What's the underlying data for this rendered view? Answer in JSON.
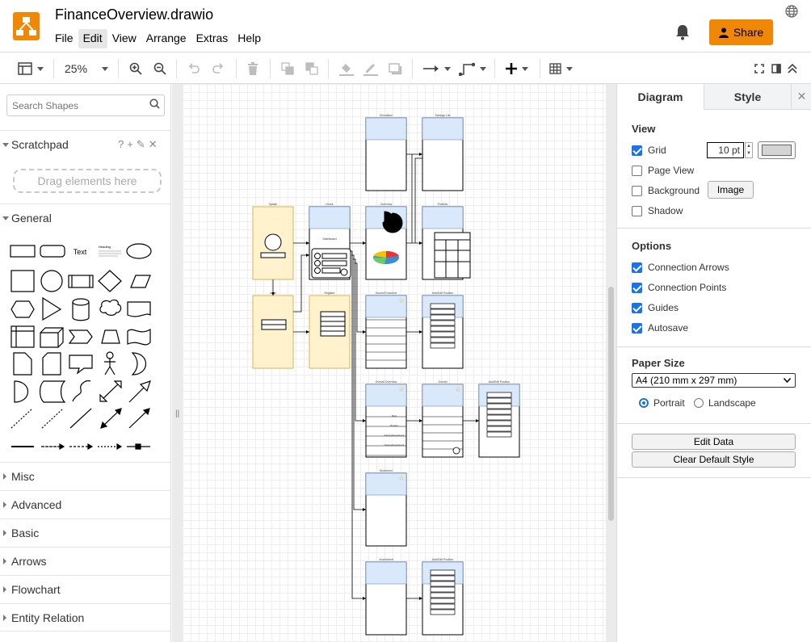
{
  "app": {
    "title": "FinanceOverview.drawio",
    "menu": [
      "File",
      "Edit",
      "View",
      "Arrange",
      "Extras",
      "Help"
    ],
    "share_label": "Share"
  },
  "toolbar": {
    "zoom": "25%"
  },
  "sidebar": {
    "search_placeholder": "Search Shapes",
    "scratchpad_label": "Scratchpad",
    "scratchpad_drop": "Drag elements here",
    "general_label": "General",
    "shape_text_label": "Text",
    "shape_heading_label": "Heading",
    "sections": [
      "Misc",
      "Advanced",
      "Basic",
      "Arrows",
      "Flowchart",
      "Entity Relation"
    ]
  },
  "diagram": {
    "screens": [
      {
        "id": "s1",
        "label": "Simulation"
      },
      {
        "id": "s2",
        "label": "Savings List"
      },
      {
        "id": "s3",
        "label": "Splash"
      },
      {
        "id": "s4",
        "label": "Home"
      },
      {
        "id": "s5",
        "label": "Overview"
      },
      {
        "id": "s6",
        "label": "Portfolio"
      },
      {
        "id": "s7",
        "label": "Login"
      },
      {
        "id": "s8",
        "label": "Register"
      },
      {
        "id": "s9",
        "label": "Income/Outcome"
      },
      {
        "id": "s10",
        "label": "Add/Edit Position"
      },
      {
        "id": "s11",
        "label": "Overall Overview"
      },
      {
        "id": "s12",
        "label": "Overall"
      },
      {
        "id": "s13",
        "label": "Add/Edit Position"
      },
      {
        "id": "s14",
        "label": "Movement"
      },
      {
        "id": "s15",
        "label": "Investment"
      },
      {
        "id": "s16",
        "label": "Add/Edit Position"
      }
    ],
    "home_dashboard_label": "Dashboard",
    "portfolio_table_label": "Table",
    "overall_rows": [
      "Main",
      "Budget",
      "Saving/Investment",
      "Saving/Investment"
    ]
  },
  "format_panel": {
    "tabs": [
      "Diagram",
      "Style"
    ],
    "view": {
      "heading": "View",
      "grid": {
        "label": "Grid",
        "checked": true,
        "size": "10 pt"
      },
      "page_view": {
        "label": "Page View",
        "checked": false
      },
      "background": {
        "label": "Background",
        "checked": false,
        "button": "Image"
      },
      "shadow": {
        "label": "Shadow",
        "checked": false
      }
    },
    "options": {
      "heading": "Options",
      "items": [
        {
          "label": "Connection Arrows",
          "checked": true
        },
        {
          "label": "Connection Points",
          "checked": true
        },
        {
          "label": "Guides",
          "checked": true
        },
        {
          "label": "Autosave",
          "checked": true
        }
      ]
    },
    "paper": {
      "heading": "Paper Size",
      "size": "A4 (210 mm x 297 mm)",
      "portrait": "Portrait",
      "landscape": "Landscape",
      "orientation": "Portrait"
    },
    "buttons": {
      "edit_data": "Edit Data",
      "clear_style": "Clear Default Style"
    }
  },
  "colors": {
    "accent": "#f08705",
    "screen_header": "#dae8fc",
    "screen_yellow": "#fff2cc",
    "checkbox": "#1a73e8"
  }
}
